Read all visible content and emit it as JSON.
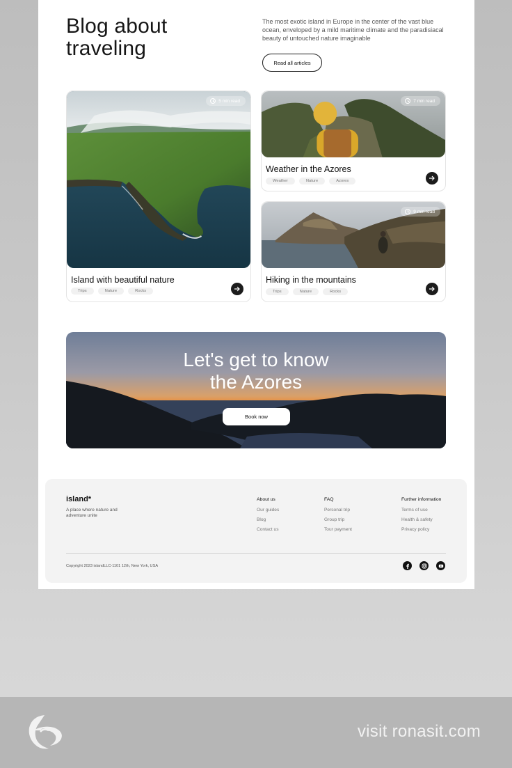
{
  "hero": {
    "title_line1": "Blog about",
    "title_line2": "traveling",
    "description": "The most exotic island in Europe in the center of the vast blue ocean, enveloped by a mild maritime climate and the paradisiacal beauty of untouched nature imaginable",
    "read_all_label": "Read all articles"
  },
  "cards": [
    {
      "title": "Island with beautiful nature",
      "read_time": "5 min read",
      "tags": [
        "Trips",
        "Nature",
        "Rocks"
      ]
    },
    {
      "title": "Weather in the Azores",
      "read_time": "7 min read",
      "tags": [
        "Weather",
        "Nature",
        "Azores"
      ]
    },
    {
      "title": "Hiking in the mountains",
      "read_time": "9 min read",
      "tags": [
        "Trips",
        "Nature",
        "Rocks"
      ]
    }
  ],
  "banner": {
    "title_line1": "Let's get to know",
    "title_line2": "the Azores",
    "button_label": "Book now"
  },
  "footer": {
    "logo": "island*",
    "tagline": "A place where nature and adventure unite",
    "columns": [
      {
        "heading": "About us",
        "links": [
          "Our guides",
          "Blog",
          "Contact us"
        ]
      },
      {
        "heading": "FAQ",
        "links": [
          "Personal trip",
          "Group trip",
          "Tour payment"
        ]
      },
      {
        "heading": "Further information",
        "links": [
          "Terms of use",
          "Health & safety",
          "Privacy policy"
        ]
      }
    ],
    "copyright": "Copyright 2023 islandLLC-1101 12th, New York, USA",
    "social_icons": [
      "facebook-icon",
      "instagram-icon",
      "youtube-icon"
    ]
  },
  "watermark": {
    "text": "visit ronasit.com"
  },
  "colors": {
    "accent_dark": "#1c1c1c",
    "page_bg": "#ffffff",
    "footer_bg": "#f3f3f3"
  }
}
